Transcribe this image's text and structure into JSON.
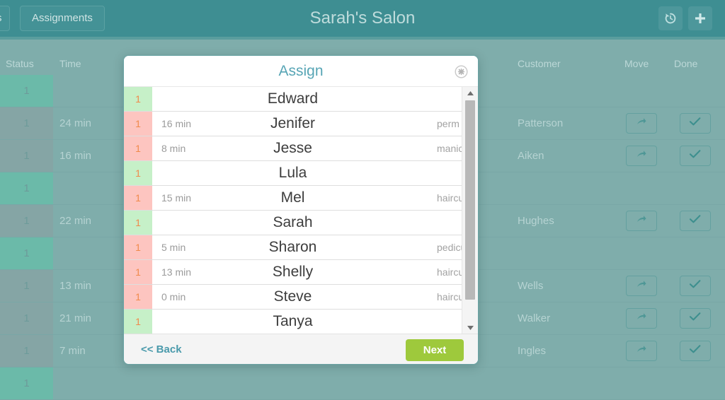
{
  "topbar": {
    "prev_tab_label": "s",
    "assignments_tab_label": "Assignments",
    "app_title": "Sarah's Salon",
    "history_icon": "history-icon",
    "add_icon": "plus-icon"
  },
  "table": {
    "headers": {
      "status": "Status",
      "time": "Time",
      "customer": "Customer",
      "move": "Move",
      "done": "Done"
    },
    "rows": [
      {
        "status": "1",
        "time": "",
        "customer": "",
        "state": "free",
        "has_actions": false
      },
      {
        "status": "1",
        "time": "24 min",
        "customer": "Patterson",
        "state": "busy",
        "has_actions": true
      },
      {
        "status": "1",
        "time": "16 min",
        "customer": "Aiken",
        "state": "busy",
        "has_actions": true
      },
      {
        "status": "1",
        "time": "",
        "customer": "",
        "state": "free",
        "has_actions": false
      },
      {
        "status": "1",
        "time": "22 min",
        "customer": "Hughes",
        "state": "busy",
        "has_actions": true
      },
      {
        "status": "1",
        "time": "",
        "customer": "",
        "state": "free",
        "has_actions": false
      },
      {
        "status": "1",
        "time": "13 min",
        "customer": "Wells",
        "state": "busy",
        "has_actions": true
      },
      {
        "status": "1",
        "time": "21 min",
        "customer": "Walker",
        "state": "busy",
        "has_actions": true
      },
      {
        "status": "1",
        "time": "7 min",
        "customer": "Ingles",
        "state": "busy",
        "has_actions": true
      },
      {
        "status": "1",
        "time": "",
        "customer": "",
        "state": "free",
        "has_actions": false
      }
    ]
  },
  "modal": {
    "title": "Assign",
    "close_icon": "close-circle-icon",
    "list": [
      {
        "badge": "1",
        "time": "",
        "name": "Edward",
        "service": "",
        "state": "free"
      },
      {
        "badge": "1",
        "time": "16 min",
        "name": "Jenifer",
        "service": "perm",
        "state": "busy"
      },
      {
        "badge": "1",
        "time": "8 min",
        "name": "Jesse",
        "service": "manicure",
        "state": "busy"
      },
      {
        "badge": "1",
        "time": "",
        "name": "Lula",
        "service": "",
        "state": "free"
      },
      {
        "badge": "1",
        "time": "15 min",
        "name": "Mel",
        "service": "haircut",
        "state": "busy"
      },
      {
        "badge": "1",
        "time": "",
        "name": "Sarah",
        "service": "",
        "state": "free"
      },
      {
        "badge": "1",
        "time": "5 min",
        "name": "Sharon",
        "service": "pedicure",
        "state": "busy"
      },
      {
        "badge": "1",
        "time": "13 min",
        "name": "Shelly",
        "service": "haircut",
        "state": "busy"
      },
      {
        "badge": "1",
        "time": "0 min",
        "name": "Steve",
        "service": "haircut",
        "state": "busy"
      },
      {
        "badge": "1",
        "time": "",
        "name": "Tanya",
        "service": "",
        "state": "free"
      }
    ],
    "scrollbar": {
      "up_icon": "caret-up-icon",
      "down_icon": "caret-down-icon"
    },
    "footer": {
      "back_label": "<< Back",
      "next_label": "Next"
    }
  },
  "colors": {
    "brand_teal": "#3e8e92",
    "page_bg": "#7fadab",
    "accent_green": "#9ec93c",
    "badge_free": "#c6f0c8",
    "badge_busy": "#fdc5c0",
    "badge_text": "#f08a4b",
    "title_teal": "#57a5b5"
  }
}
